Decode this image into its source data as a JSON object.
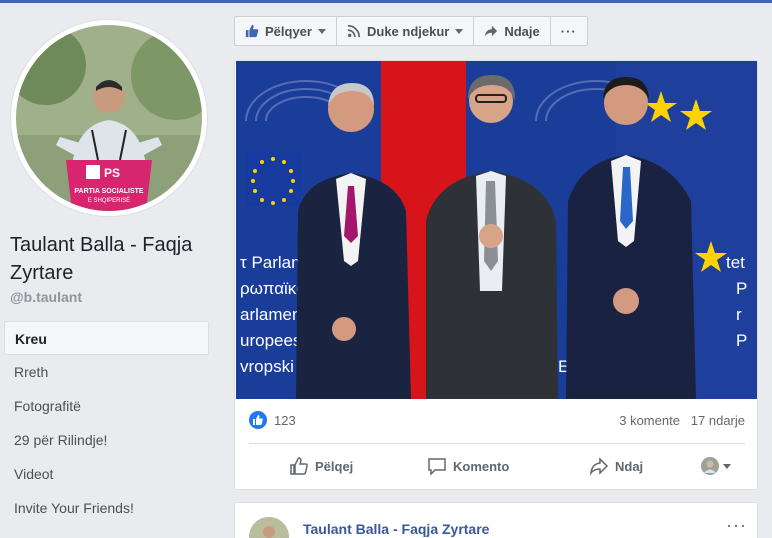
{
  "page": {
    "name": "Taulant Balla - Faqja Zyrtare",
    "handle": "@b.taulant"
  },
  "nav": [
    {
      "label": "Kreu",
      "active": true
    },
    {
      "label": "Rreth"
    },
    {
      "label": "Fotografitë"
    },
    {
      "label": "29 për Rilindje!"
    },
    {
      "label": "Videot"
    },
    {
      "label": "Invite Your Friends!"
    }
  ],
  "page_actions": {
    "like": "Pëlqyer",
    "follow": "Duke ndjekur",
    "share": "Ndaje",
    "more": "···"
  },
  "post": {
    "reaction_count": "123",
    "comments": "3 komente",
    "shares": "17 ndarje",
    "actions": {
      "like": "Pëlqej",
      "comment": "Komento",
      "share": "Ndaj"
    },
    "photo_text": {
      "banner_lines": [
        "τ Parlam",
        "ρωπαϊκό κ",
        "arlamento",
        "uropees Parlem",
        "vropski parl"
      ],
      "banner_right": [
        "tet",
        "P",
        "r",
        "P",
        "Euro"
      ],
      "podium_logo": "PS",
      "podium_line1": "PARTIA SOCIALISTE",
      "podium_line2": "E SHQIPERISË"
    }
  },
  "next_post": {
    "author": "Taulant Balla - Faqja Zyrtare",
    "more": "···"
  },
  "colors": {
    "brand": "#4267b2",
    "link": "#385898",
    "like_blue": "#2078f4"
  }
}
